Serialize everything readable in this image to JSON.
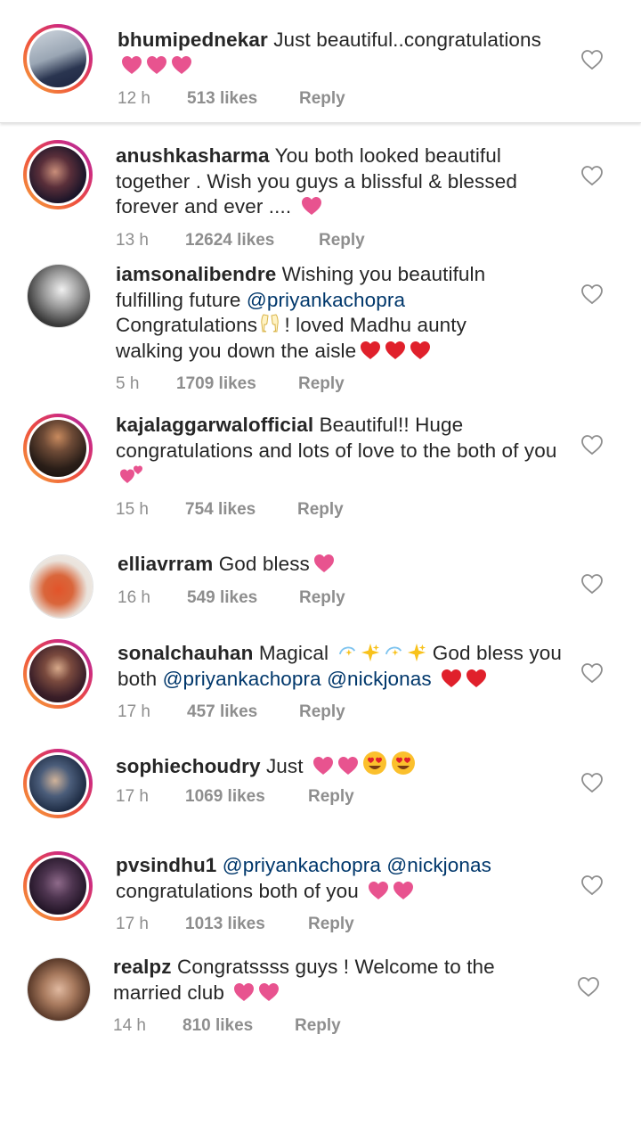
{
  "comments": [
    {
      "username": "bhumipednekar",
      "text": "Just beautiful..congratulations",
      "emoji": "pink-hearts",
      "time": "12 h",
      "likes": "513 likes",
      "reply": "Reply"
    },
    {
      "username": "anushkasharma",
      "text": "You both looked beautiful together . Wish you guys a blissful & blessed forever and ever ....",
      "emoji": "pink-heart",
      "time": "13 h",
      "likes": "12624 likes",
      "reply": "Reply"
    },
    {
      "username": "iamsonalibendre",
      "text_a": "Wishing you beautifuln fulfilling future",
      "mention": "@priyankachopra",
      "text_b": "Congratulations",
      "text_c": "! loved Madhu aunty walking you down the aisle",
      "emoji": "clinking-glasses, red-hearts",
      "time": "5 h",
      "likes": "1709 likes",
      "reply": "Reply"
    },
    {
      "username": "kajalaggarwalofficial",
      "text": "Beautiful!! Huge congratulations and lots of love to the both of you",
      "emoji": "two-hearts",
      "time": "15 h",
      "likes": "754 likes",
      "reply": "Reply"
    },
    {
      "username": "elliavrram",
      "text": "God bless",
      "emoji": "pink-heart",
      "time": "16 h",
      "likes": "549 likes",
      "reply": "Reply"
    },
    {
      "username": "sonalchauhan",
      "text_a": "Magical",
      "text_b": "God bless you both",
      "mention_a": "@priyankachopra",
      "mention_b": "@nickjonas",
      "emoji": "dizzy-sparkles, red-hearts",
      "time": "17 h",
      "likes": "457 likes",
      "reply": "Reply"
    },
    {
      "username": "sophiechoudry",
      "text": "Just",
      "emoji": "pink-hearts, heart-eyes",
      "time": "17 h",
      "likes": "1069 likes",
      "reply": "Reply"
    },
    {
      "username": "pvsindhu1",
      "mention_a": "@priyankachopra",
      "mention_b": "@nickjonas",
      "text": "congratulations both of you",
      "emoji": "pink-hearts",
      "time": "17 h",
      "likes": "1013 likes",
      "reply": "Reply"
    },
    {
      "username": "realpz",
      "text": "Congratssss guys ! Welcome to the married club",
      "emoji": "pink-hearts",
      "time": "14 h",
      "likes": "810 likes",
      "reply": "Reply"
    }
  ],
  "colors": {
    "text": "#262626",
    "meta": "#8e8e8e",
    "mention": "#00376b",
    "pink_heart": "#e8538f",
    "red_heart": "#e0202b"
  },
  "icons": {
    "like": "heart-outline-icon"
  }
}
